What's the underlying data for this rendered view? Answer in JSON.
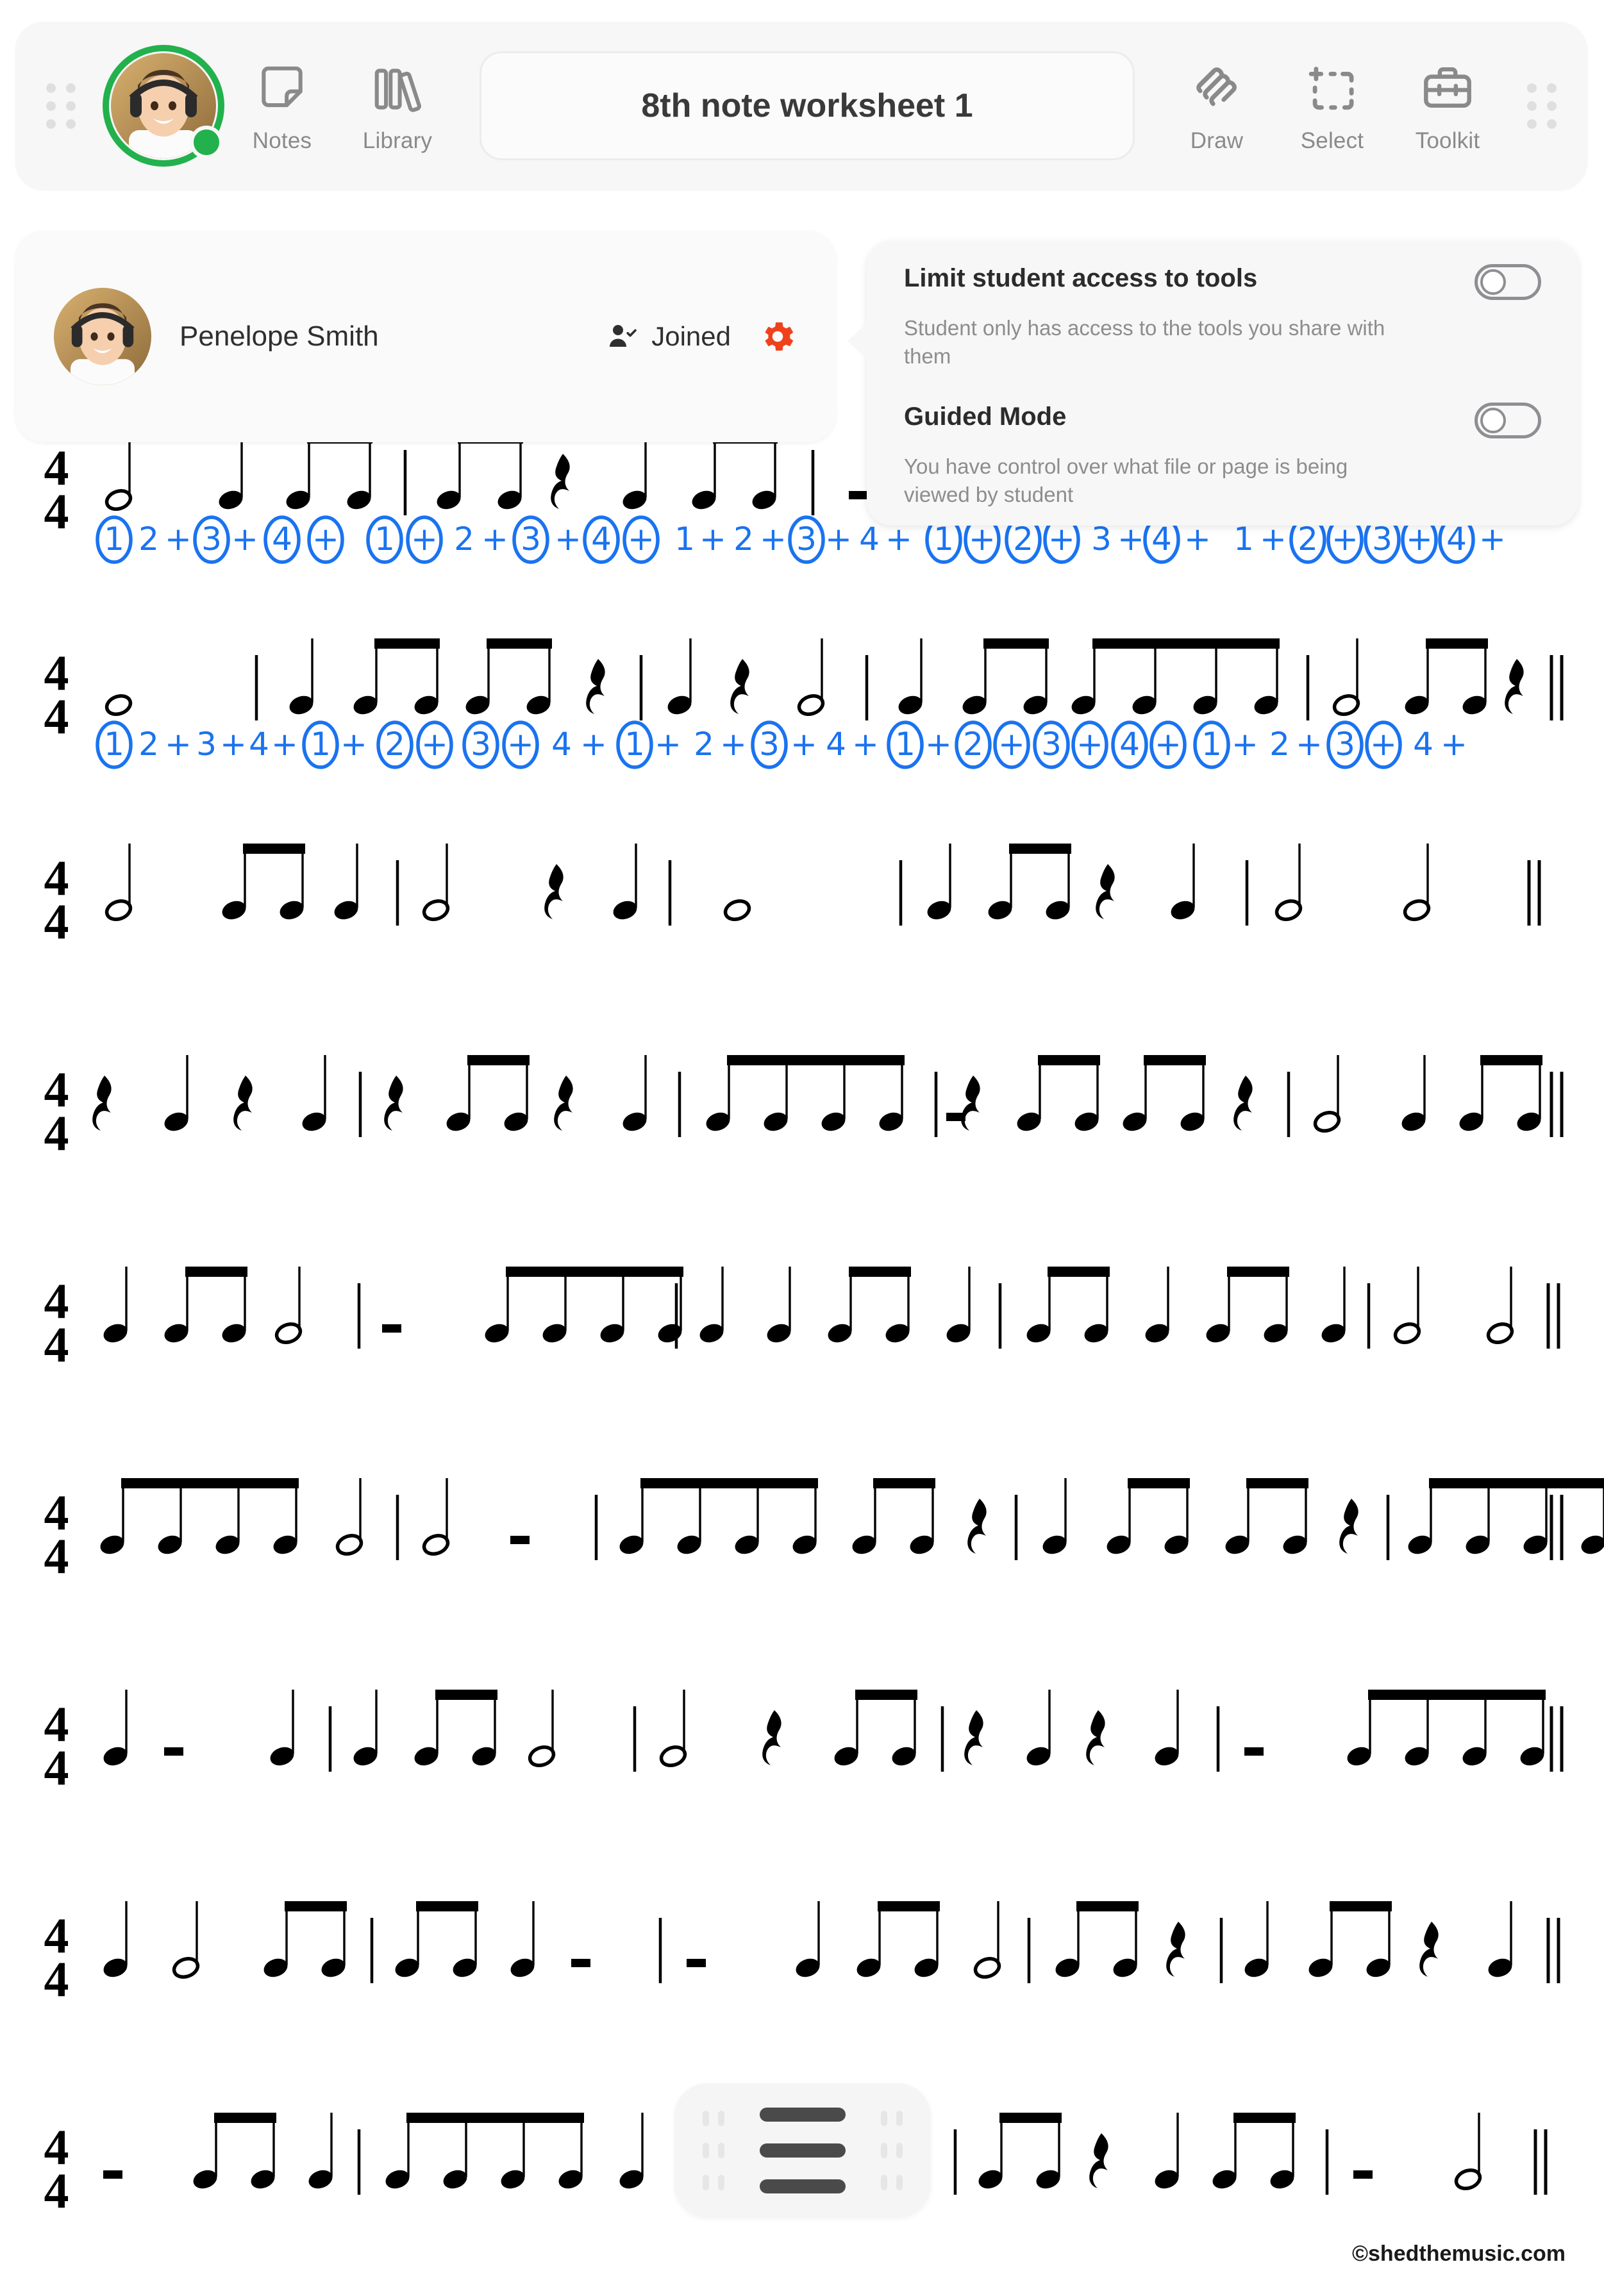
{
  "toolbar": {
    "drag_handle_left": "drag-handle",
    "drag_handle_right": "drag-handle",
    "avatar_alt": "student-avatar",
    "items": [
      {
        "label": "Notes",
        "icon": "note-page-icon"
      },
      {
        "label": "Library",
        "icon": "books-icon"
      }
    ],
    "title": "8th note worksheet 1",
    "right_items": [
      {
        "label": "Draw",
        "icon": "scribble-pen-icon"
      },
      {
        "label": "Select",
        "icon": "marquee-select-icon"
      },
      {
        "label": "Toolkit",
        "icon": "toolbox-icon"
      }
    ]
  },
  "student_card": {
    "name": "Penelope Smith",
    "status": "Joined",
    "status_icon": "person-check-icon",
    "settings_icon": "gear-icon",
    "settings_icon_color": "#f0411c"
  },
  "settings_popup": {
    "options": [
      {
        "title": "Limit student access to tools",
        "description": "Student only has access to the tools you share with them",
        "toggle_on": false
      },
      {
        "title": "Guided Mode",
        "description": "You have control over what file or page is being viewed by student",
        "toggle_on": false
      }
    ]
  },
  "float_menu": {
    "icon": "hamburger-menu-icon",
    "handle_left": "drag-handle",
    "handle_right": "drag-handle"
  },
  "footer": {
    "credit": "©shedthemusic.com"
  },
  "worksheet": {
    "time_signature_top": "4",
    "time_signature_bottom": "4",
    "annotation_color": "#1a73f0",
    "lines": [
      {
        "index": 1,
        "annotated": true,
        "annotation_text": "1 2 + 3 + 4 + | 1 + 2 + 3 + 4 + | 1 + 2 + 3 + 4 + | 1 + 2 + 3 + 4 + | 1 + 2 + 3 + 4 +",
        "circled_counts": [
          "1",
          "3",
          "4",
          "+",
          "1",
          "+",
          "3",
          "4",
          "+",
          "3",
          "1",
          "+",
          "2",
          "+",
          "4",
          "2",
          "+",
          "3",
          "+",
          "4"
        ]
      },
      {
        "index": 2,
        "annotated": true,
        "annotation_text": "1 2 + 3 + 4 + | 1 + 2 + 3 + 4 + | 1 + 2 + 3 + 4 + | 1 + 2 + 3 + 4 + | 1 2 + 3 + 4 +",
        "circled_counts": [
          "1",
          "1",
          "2",
          "+",
          "3",
          "+",
          "1",
          "3",
          "1",
          "2",
          "+",
          "3",
          "+",
          "4",
          "+",
          "1",
          "3",
          "+"
        ]
      },
      {
        "index": 3,
        "annotated": false
      },
      {
        "index": 4,
        "annotated": false
      },
      {
        "index": 5,
        "annotated": false
      },
      {
        "index": 6,
        "annotated": false
      },
      {
        "index": 7,
        "annotated": false
      },
      {
        "index": 8,
        "annotated": false
      },
      {
        "index": 9,
        "annotated": false
      }
    ]
  }
}
